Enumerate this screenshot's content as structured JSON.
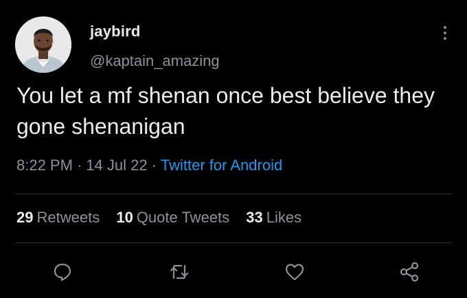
{
  "user": {
    "display_name": "jaybird",
    "handle": "@kaptain_amazing",
    "avatar_icon": "profile-photo"
  },
  "tweet": {
    "text": "You let a mf shenan once best believe they gone shenanigan",
    "time": "8:22 PM",
    "date": "14 Jul 22",
    "separator": "·",
    "source": "Twitter for Android"
  },
  "stats": {
    "retweets": {
      "count": "29",
      "label": "Retweets"
    },
    "quote_tweets": {
      "count": "10",
      "label": "Quote Tweets"
    },
    "likes": {
      "count": "33",
      "label": "Likes"
    }
  },
  "actions": {
    "reply_icon": "reply-icon",
    "retweet_icon": "retweet-icon",
    "like_icon": "heart-icon",
    "share_icon": "share-icon"
  },
  "colors": {
    "background": "#000000",
    "text": "#ececec",
    "secondary": "#8b9298",
    "link": "#1d9bf0",
    "divider": "#2f3336"
  }
}
